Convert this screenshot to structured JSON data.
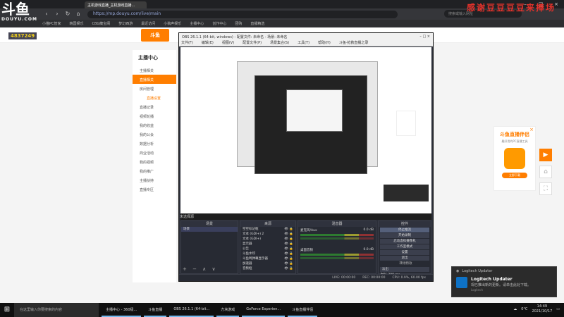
{
  "browser": {
    "tabs": [
      "主机游戏直播_主机游戏直播..."
    ],
    "address": "https://mp.douyu.com/live/main",
    "search_placeholder": "搜索或输入网址",
    "bookmarks": [
      "小猫PC管家",
      "韩国娱乐",
      "CBG藏宝阁",
      "梦幻西游",
      "最近访问",
      "小稿声娱乐",
      "主播中心",
      "创作中心",
      "团购",
      "直播精选"
    ]
  },
  "overlay": {
    "logo_glyph": "斗鱼",
    "logo_text": "DOUYU.COM",
    "room_id": "4837249",
    "banner": "感谢豆豆豆豆来捧场"
  },
  "site": {
    "logo": "斗鱼",
    "sidebar": {
      "title": "主播中心",
      "items": [
        "主播相关",
        "直播相关",
        "房间管理",
        "直播设置",
        "直播记录",
        "视频轮播",
        "我的收益",
        "我的公会",
        "数据分析",
        "商业活动",
        "我的视频",
        "我的推广",
        "主播扶持",
        "直播专区"
      ]
    },
    "ad": {
      "title": "斗鱼直播伴侣",
      "subtitle": "最好用的PC直播工具",
      "button": "立即下载",
      "close": "×"
    }
  },
  "obs": {
    "title": "OBS 26.1.1 (64-bit, windows) - 配置文件: 未命名 - 场景: 未命名",
    "menu": [
      "文件(F)",
      "编辑(E)",
      "视图(V)",
      "配置文件(P)",
      "场景集合(S)",
      "工具(T)",
      "帮助(H)",
      "斗鱼·抢救直播之录"
    ],
    "scene_label": "未选择源",
    "panels": {
      "scenes": "场景",
      "sources": "来源",
      "mixer": "混音器",
      "controls": "控件"
    },
    "scenes": [
      "场景"
    ],
    "sources": [
      "空空标记框",
      "文本 (GDI+) 2",
      "文本 (GDI+)",
      "显示器",
      "公告",
      "斗鱼水印",
      "斗鱼哟弹幕显示器",
      "加速器",
      "音频框",
      "摄像头框"
    ],
    "mixer": [
      {
        "name": "麦克风/Aux",
        "db": "0.0 dB"
      },
      {
        "name": "桌面音频",
        "db": "0.0 dB"
      }
    ],
    "controls": [
      "停止推流",
      "开始录制",
      "启动虚拟摄像机",
      "工作室模式",
      "设置",
      "退出"
    ],
    "transitions": {
      "label": "转场特效",
      "value": "淡出",
      "duration_label": "时长",
      "duration": "300 ms"
    },
    "status": [
      "LIVE: 00:00:00",
      "REC: 00:00:00",
      "CPU: 0.9%, 60.00 fps"
    ]
  },
  "notification": {
    "app_header": "Logitech Updater",
    "title": "Logitech Updater",
    "message": "现已推出新的更新。请单击此处下载。",
    "app": "Logitech"
  },
  "taskbar": {
    "search": "在这里输入你要搜索的内容",
    "apps": [
      "主播中心 - 360极...",
      "斗鱼直播",
      "OBS 26.1.1 (64-bit...",
      "方块游戏",
      "GeForce Experien...",
      "斗鱼直播伴侣"
    ],
    "temperature": "0°C",
    "time": "14:49",
    "date": "2021/10/17"
  }
}
